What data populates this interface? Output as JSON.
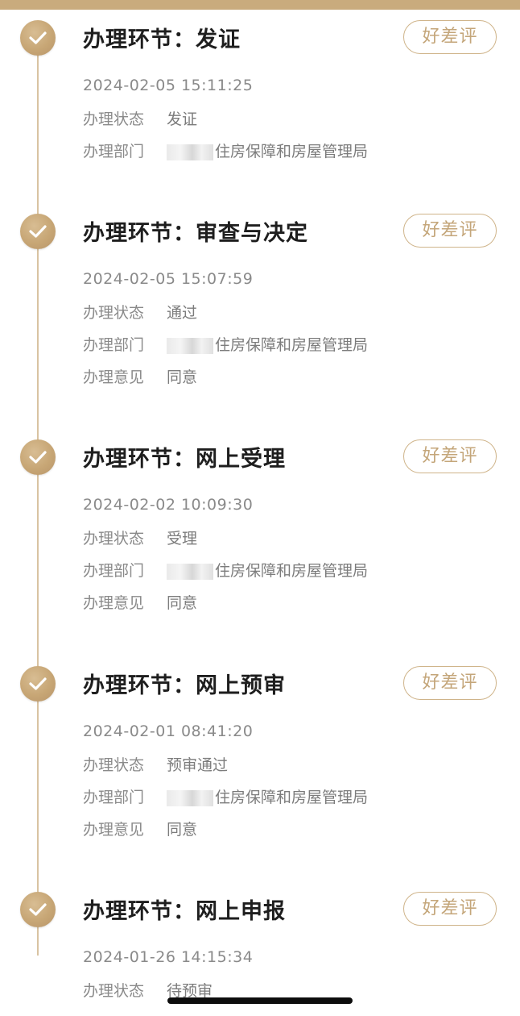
{
  "rate_button_label": "好差评",
  "steps": [
    {
      "title": "办理环节：发证",
      "datetime": "2024-02-05 15:11:25",
      "status_label": "办理状态",
      "status_value": "发证",
      "dept_label": "办理部门",
      "dept_value": "住房保障和房屋管理局",
      "opinion_label": "",
      "opinion_value": ""
    },
    {
      "title": "办理环节：审查与决定",
      "datetime": "2024-02-05 15:07:59",
      "status_label": "办理状态",
      "status_value": "通过",
      "dept_label": "办理部门",
      "dept_value": "住房保障和房屋管理局",
      "opinion_label": "办理意见",
      "opinion_value": "同意"
    },
    {
      "title": "办理环节：网上受理",
      "datetime": "2024-02-02 10:09:30",
      "status_label": "办理状态",
      "status_value": "受理",
      "dept_label": "办理部门",
      "dept_value": "住房保障和房屋管理局",
      "opinion_label": "办理意见",
      "opinion_value": "同意"
    },
    {
      "title": "办理环节：网上预审",
      "datetime": "2024-02-01 08:41:20",
      "status_label": "办理状态",
      "status_value": "预审通过",
      "dept_label": "办理部门",
      "dept_value": "住房保障和房屋管理局",
      "opinion_label": "办理意见",
      "opinion_value": "同意"
    },
    {
      "title": "办理环节：网上申报",
      "datetime": "2024-01-26 14:15:34",
      "status_label": "办理状态",
      "status_value": "待预审",
      "dept_label": "",
      "dept_value": "",
      "opinion_label": "",
      "opinion_value": ""
    }
  ],
  "icons": {
    "step_marker": "check-icon"
  },
  "colors": {
    "accent": "#c9ab7d",
    "timeline": "#d9c3a2"
  }
}
